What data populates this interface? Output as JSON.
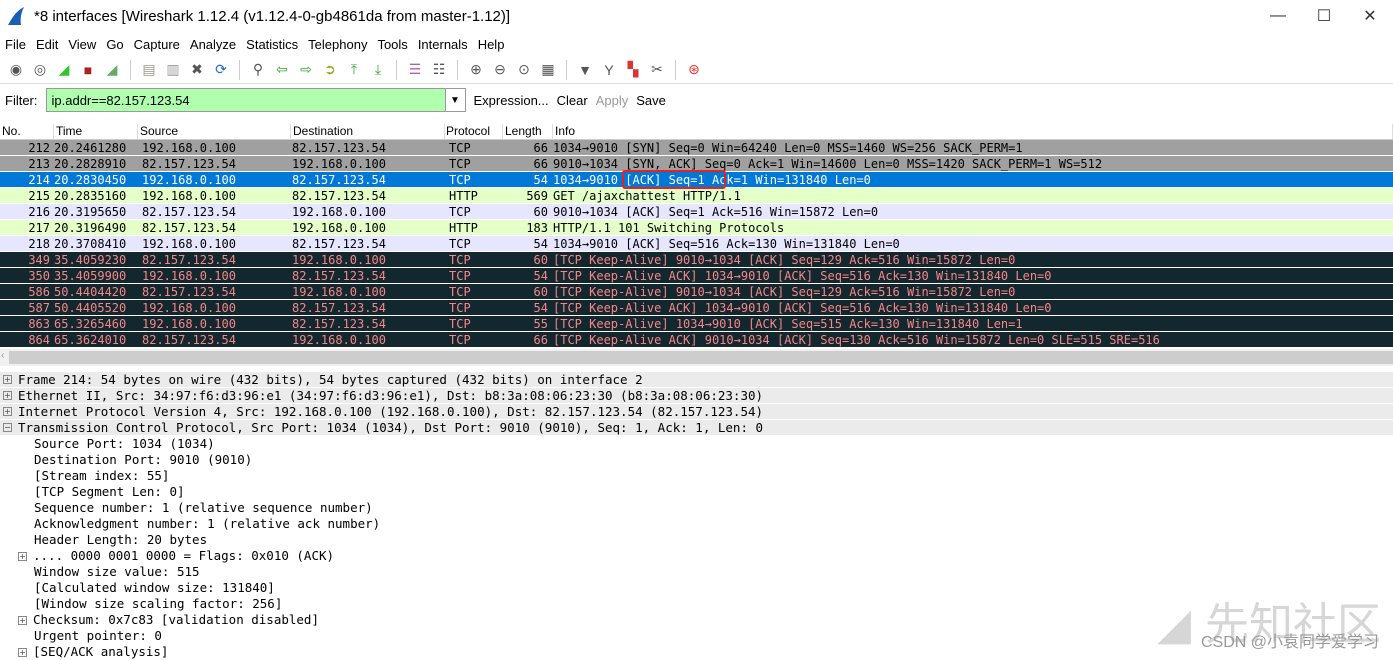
{
  "window": {
    "title": "*8 interfaces  [Wireshark 1.12.4  (v1.12.4-0-gb4861da from master-1.12)]",
    "controls": [
      "—",
      "☐",
      "✕"
    ]
  },
  "menu": [
    "File",
    "Edit",
    "View",
    "Go",
    "Capture",
    "Analyze",
    "Statistics",
    "Telephony",
    "Tools",
    "Internals",
    "Help"
  ],
  "toolbar": [
    {
      "icon": "interfaces-icon",
      "glyph": "◉",
      "color": "#555"
    },
    {
      "icon": "capture-options-icon",
      "glyph": "◎",
      "color": "#555"
    },
    {
      "icon": "start-capture-icon",
      "glyph": "◢",
      "color": "#2fc52f"
    },
    {
      "icon": "stop-capture-icon",
      "glyph": "■",
      "color": "#a22"
    },
    {
      "icon": "restart-capture-icon",
      "glyph": "◢",
      "color": "#6a6"
    },
    {
      "sep": true
    },
    {
      "icon": "open-file-icon",
      "glyph": "▤",
      "color": "#998"
    },
    {
      "icon": "save-file-icon",
      "glyph": "▥",
      "color": "#999"
    },
    {
      "icon": "close-file-icon",
      "glyph": "✖",
      "color": "#555"
    },
    {
      "icon": "reload-icon",
      "glyph": "⟳",
      "color": "#2a6ad0"
    },
    {
      "sep": true
    },
    {
      "icon": "find-packet-icon",
      "glyph": "⚲",
      "color": "#555"
    },
    {
      "icon": "go-back-icon",
      "glyph": "⇦",
      "color": "#3a3"
    },
    {
      "icon": "go-forward-icon",
      "glyph": "⇨",
      "color": "#3a3"
    },
    {
      "icon": "go-to-packet-icon",
      "glyph": "➲",
      "color": "#9a2"
    },
    {
      "icon": "first-packet-icon",
      "glyph": "⤒",
      "color": "#3a3"
    },
    {
      "icon": "last-packet-icon",
      "glyph": "⤓",
      "color": "#3a3"
    },
    {
      "sep": true
    },
    {
      "icon": "colorize-icon",
      "glyph": "☰",
      "color": "#a6a"
    },
    {
      "icon": "auto-scroll-icon",
      "glyph": "☷",
      "color": "#555"
    },
    {
      "sep": true
    },
    {
      "icon": "zoom-in-icon",
      "glyph": "⊕",
      "color": "#555"
    },
    {
      "icon": "zoom-out-icon",
      "glyph": "⊖",
      "color": "#555"
    },
    {
      "icon": "zoom-normal-icon",
      "glyph": "⊙",
      "color": "#555"
    },
    {
      "icon": "resize-columns-icon",
      "glyph": "▦",
      "color": "#555"
    },
    {
      "sep": true
    },
    {
      "icon": "capture-filters-icon",
      "glyph": "▼",
      "color": "#555"
    },
    {
      "icon": "display-filters-icon",
      "glyph": "Y",
      "color": "#555"
    },
    {
      "icon": "coloring-rules-icon",
      "glyph": "▚",
      "color": "#d33"
    },
    {
      "icon": "preferences-icon",
      "glyph": "✂",
      "color": "#555"
    },
    {
      "sep": true
    },
    {
      "icon": "help-icon",
      "glyph": "⊛",
      "color": "#d33"
    }
  ],
  "filter": {
    "label": "Filter:",
    "value": "ip.addr==82.157.123.54",
    "expression": "Expression...",
    "clear": "Clear",
    "apply": "Apply",
    "save": "Save"
  },
  "columns": [
    "No.",
    "Time",
    "Source",
    "Destination",
    "Protocol",
    "Length",
    "Info"
  ],
  "packets": [
    {
      "no": "212",
      "time": "20.2461280",
      "src": "192.168.0.100",
      "dst": "82.157.123.54",
      "proto": "TCP",
      "len": "66",
      "info": "1034→9010 [SYN] Seq=0 Win=64240 Len=0 MSS=1460 WS=256 SACK_PERM=1",
      "style": "syn"
    },
    {
      "no": "213",
      "time": "20.2828910",
      "src": "82.157.123.54",
      "dst": "192.168.0.100",
      "proto": "TCP",
      "len": "66",
      "info": "9010→1034 [SYN, ACK] Seq=0 Ack=1 Win=14600 Len=0 MSS=1420 SACK_PERM=1 WS=512",
      "style": "syn"
    },
    {
      "no": "214",
      "time": "20.2830450",
      "src": "192.168.0.100",
      "dst": "82.157.123.54",
      "proto": "TCP",
      "len": "54",
      "info": "1034→9010 [ACK] Seq=1 Ack=1 Win=131840 Len=0",
      "style": "sel",
      "selected": true,
      "highlighted_text": "[ACK] Seq=1"
    },
    {
      "no": "215",
      "time": "20.2835160",
      "src": "192.168.0.100",
      "dst": "82.157.123.54",
      "proto": "HTTP",
      "len": "569",
      "info": "GET /ajaxchattest HTTP/1.1",
      "style": "http"
    },
    {
      "no": "216",
      "time": "20.3195650",
      "src": "82.157.123.54",
      "dst": "192.168.0.100",
      "proto": "TCP",
      "len": "60",
      "info": "9010→1034 [ACK] Seq=1 Ack=516 Win=15872 Len=0",
      "style": "tcp"
    },
    {
      "no": "217",
      "time": "20.3196490",
      "src": "82.157.123.54",
      "dst": "192.168.0.100",
      "proto": "HTTP",
      "len": "183",
      "info": "HTTP/1.1 101 Switching Protocols",
      "style": "http"
    },
    {
      "no": "218",
      "time": "20.3708410",
      "src": "192.168.0.100",
      "dst": "82.157.123.54",
      "proto": "TCP",
      "len": "54",
      "info": "1034→9010 [ACK] Seq=516 Ack=130 Win=131840 Len=0",
      "style": "tcp"
    },
    {
      "no": "349",
      "time": "35.4059230",
      "src": "82.157.123.54",
      "dst": "192.168.0.100",
      "proto": "TCP",
      "len": "60",
      "info": "[TCP Keep-Alive] 9010→1034 [ACK] Seq=129 Ack=516 Win=15872 Len=0",
      "style": "ka"
    },
    {
      "no": "350",
      "time": "35.4059900",
      "src": "192.168.0.100",
      "dst": "82.157.123.54",
      "proto": "TCP",
      "len": "54",
      "info": "[TCP Keep-Alive ACK] 1034→9010 [ACK] Seq=516 Ack=130 Win=131840 Len=0",
      "style": "ka"
    },
    {
      "no": "586",
      "time": "50.4404420",
      "src": "82.157.123.54",
      "dst": "192.168.0.100",
      "proto": "TCP",
      "len": "60",
      "info": "[TCP Keep-Alive] 9010→1034 [ACK] Seq=129 Ack=516 Win=15872 Len=0",
      "style": "ka"
    },
    {
      "no": "587",
      "time": "50.4405520",
      "src": "192.168.0.100",
      "dst": "82.157.123.54",
      "proto": "TCP",
      "len": "54",
      "info": "[TCP Keep-Alive ACK] 1034→9010 [ACK] Seq=516 Ack=130 Win=131840 Len=0",
      "style": "ka"
    },
    {
      "no": "863",
      "time": "65.3265460",
      "src": "192.168.0.100",
      "dst": "82.157.123.54",
      "proto": "TCP",
      "len": "55",
      "info": "[TCP Keep-Alive] 1034→9010 [ACK] Seq=515 Ack=130 Win=131840 Len=1",
      "style": "ka"
    },
    {
      "no": "864",
      "time": "65.3624010",
      "src": "82.157.123.54",
      "dst": "192.168.0.100",
      "proto": "TCP",
      "len": "66",
      "info": "[TCP Keep-Alive ACK] 9010→1034 [ACK] Seq=130 Ack=516 Win=15872 Len=0 SLE=515 SRE=516",
      "style": "ka"
    }
  ],
  "details": [
    {
      "text": "Frame 214: 54 bytes on wire (432 bits), 54 bytes captured (432 bits) on interface 2",
      "level": 0,
      "expander": "+"
    },
    {
      "text": "Ethernet II, Src: 34:97:f6:d3:96:e1 (34:97:f6:d3:96:e1), Dst: b8:3a:08:06:23:30 (b8:3a:08:06:23:30)",
      "level": 0,
      "expander": "+"
    },
    {
      "text": "Internet Protocol Version 4, Src: 192.168.0.100 (192.168.0.100), Dst: 82.157.123.54 (82.157.123.54)",
      "level": 0,
      "expander": "+"
    },
    {
      "text": "Transmission Control Protocol, Src Port: 1034 (1034), Dst Port: 9010 (9010), Seq: 1, Ack: 1, Len: 0",
      "level": 0,
      "expander": "−"
    },
    {
      "text": "Source Port: 1034 (1034)",
      "level": 1
    },
    {
      "text": "Destination Port: 9010 (9010)",
      "level": 1
    },
    {
      "text": "[Stream index: 55]",
      "level": 1
    },
    {
      "text": "[TCP Segment Len: 0]",
      "level": 1
    },
    {
      "text": "Sequence number: 1    (relative sequence number)",
      "level": 1
    },
    {
      "text": "Acknowledgment number: 1    (relative ack number)",
      "level": 1
    },
    {
      "text": "Header Length: 20 bytes",
      "level": 1
    },
    {
      "text": ".... 0000 0001 0000 = Flags: 0x010 (ACK)",
      "level": 1,
      "expander": "+"
    },
    {
      "text": "Window size value: 515",
      "level": 1
    },
    {
      "text": "[Calculated window size: 131840]",
      "level": 1
    },
    {
      "text": "[Window size scaling factor: 256]",
      "level": 1
    },
    {
      "text": "Checksum: 0x7c83 [validation disabled]",
      "level": 1,
      "expander": "+"
    },
    {
      "text": "Urgent pointer: 0",
      "level": 1
    },
    {
      "text": "[SEQ/ACK analysis]",
      "level": 1,
      "expander": "+"
    }
  ],
  "watermark": {
    "logo": "先知社区",
    "credit": "CSDN @小袁同学爱学习"
  }
}
